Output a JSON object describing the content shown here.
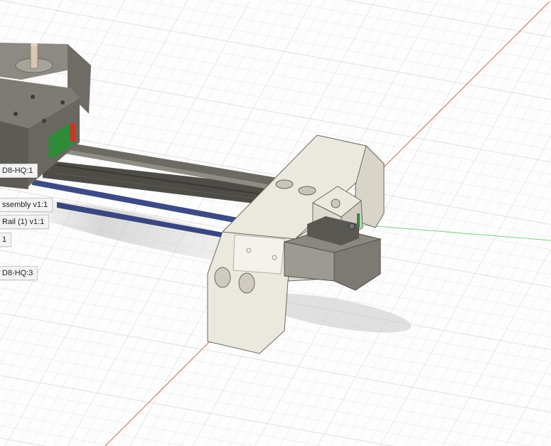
{
  "viewport": {
    "background": "#fdfdfd",
    "grid_minor_color": "#e6e6e6",
    "grid_major_color": "#d2d2d2",
    "x_axis_color": "#e06060",
    "y_axis_color": "#7ed07e"
  },
  "component_tags": [
    "D8-HQ:1",
    "ssembly v1:1",
    "Rail (1) v1:1",
    "1",
    "D8-HQ:3"
  ],
  "colors": {
    "part_body": "#ebe8de",
    "part_shade": "#cdc9bd",
    "motor_body": "#8d8a83",
    "rail_dark": "#4e4c47",
    "rail_blue": "#3c4a86",
    "carriage_green": "#2f8a3a",
    "carriage_red": "#c23a2a"
  }
}
